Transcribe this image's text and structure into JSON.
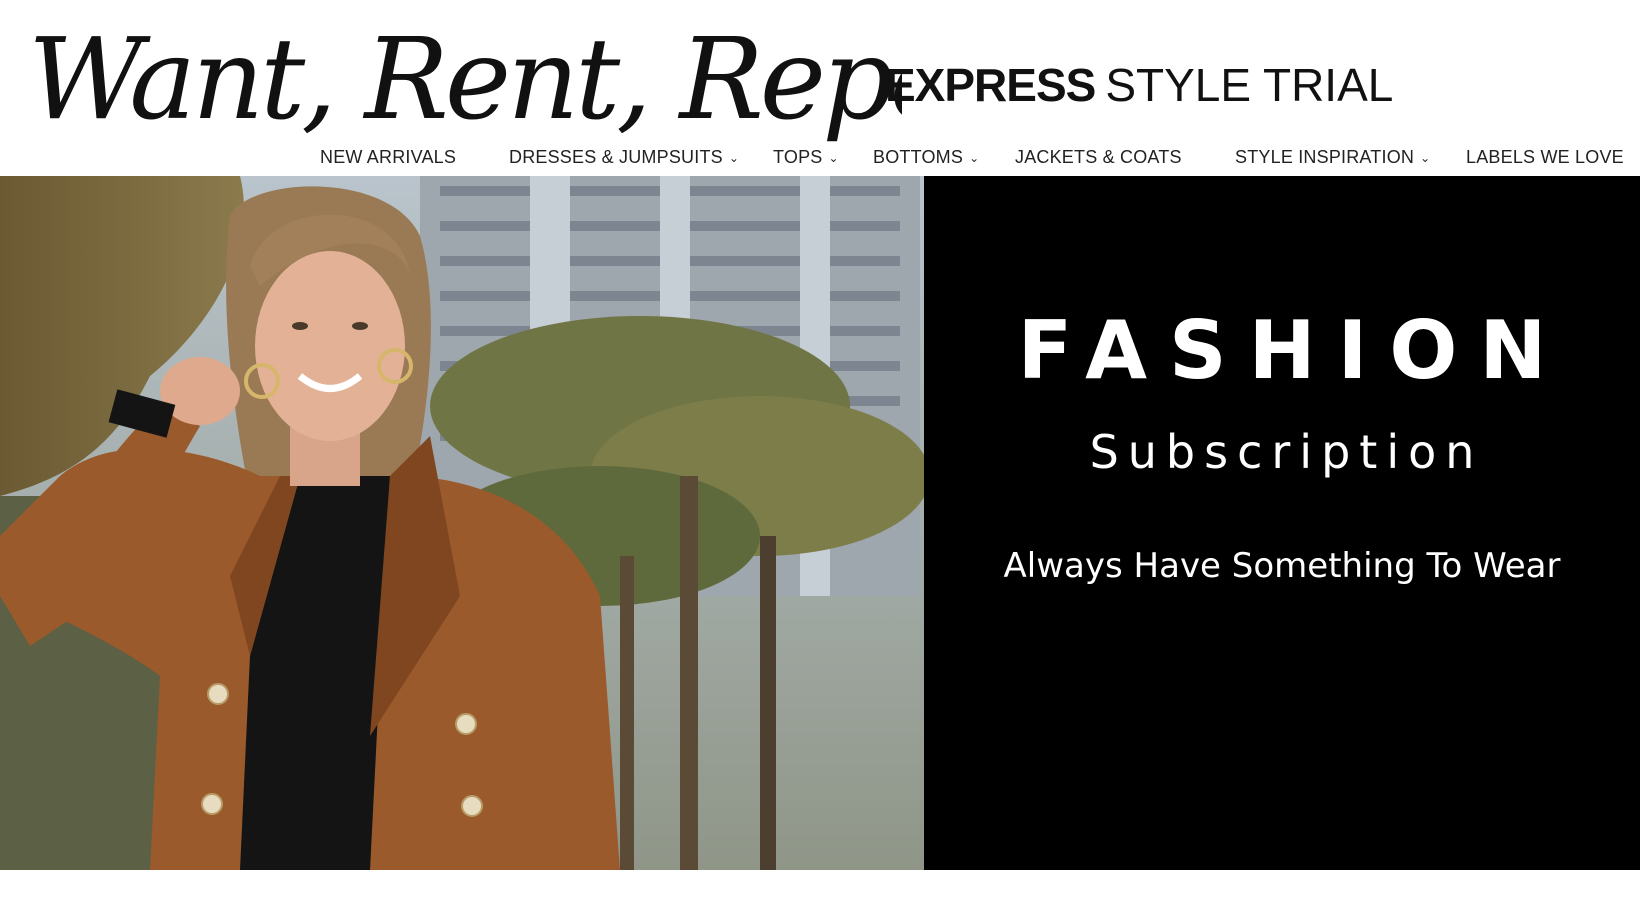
{
  "header": {
    "script_title": "Want, Rent, Repeat",
    "brand_bold": "EXPRESS",
    "brand_light": "STYLE TRIAL"
  },
  "nav": {
    "items": [
      {
        "label": "NEW ARRIVALS",
        "has_dropdown": false
      },
      {
        "label": "DRESSES & JUMPSUITS",
        "has_dropdown": true
      },
      {
        "label": "TOPS",
        "has_dropdown": true
      },
      {
        "label": "BOTTOMS",
        "has_dropdown": true
      },
      {
        "label": "JACKETS & COATS",
        "has_dropdown": false
      },
      {
        "label": "STYLE INSPIRATION",
        "has_dropdown": true
      },
      {
        "label": "LABELS WE LOVE",
        "has_dropdown": false
      }
    ],
    "dropdown_glyph": "⌄"
  },
  "hero": {
    "headline": "FASHION",
    "subheadline": "Subscription",
    "tagline": "Always Have Something To Wear"
  },
  "colors": {
    "panel_bg": "#000000",
    "panel_text": "#ffffff",
    "jacket": "#9a5a2c",
    "page_bg": "#ffffff"
  },
  "icons": {
    "dropdown": "chevron-down-icon"
  }
}
